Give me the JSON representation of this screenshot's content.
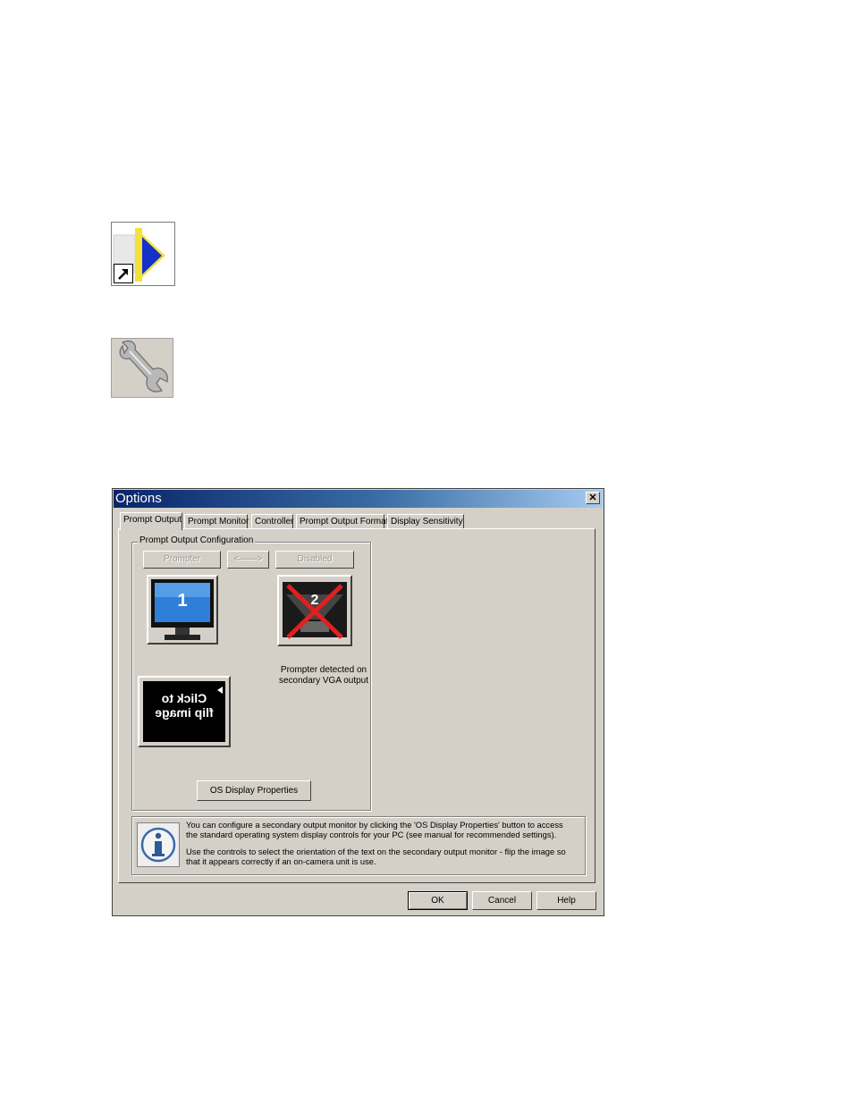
{
  "icons": {
    "shortcut": "shortcut-play-icon",
    "settings": "wrench-icon"
  },
  "dialog": {
    "title": "Options",
    "close_glyph": "✕",
    "tabs": [
      {
        "label": "Prompt Output",
        "active": true
      },
      {
        "label": "Prompt Monitor",
        "active": false
      },
      {
        "label": "Controller",
        "active": false
      },
      {
        "label": "Prompt Output Format",
        "active": false
      },
      {
        "label": "Display Sensitivity",
        "active": false
      }
    ],
    "group": {
      "legend": "Prompt Output Configuration",
      "prompter_btn": "Prompter",
      "swap_btn": "<——>",
      "disabled_btn": "Disabled",
      "monitor_number": "1",
      "prompter_number": "2",
      "caption_line1": "Prompter detected on",
      "caption_line2": "secondary VGA output",
      "flip_line1": "Click to",
      "flip_line2": "flip image",
      "os_display_btn": "OS Display Properties"
    },
    "info": {
      "para1_line1": "You can configure a secondary output monitor by clicking the 'OS Display Properties' button to access",
      "para1_line2": "the standard operating system display controls for your PC (see manual for recommended settings).",
      "para2_line1": "Use the controls to select the orientation of the text on the secondary output monitor - flip the image so",
      "para2_line2": "that it appears correctly if an on-camera unit is use."
    },
    "buttons": {
      "ok": "OK",
      "cancel": "Cancel",
      "help": "Help"
    }
  }
}
